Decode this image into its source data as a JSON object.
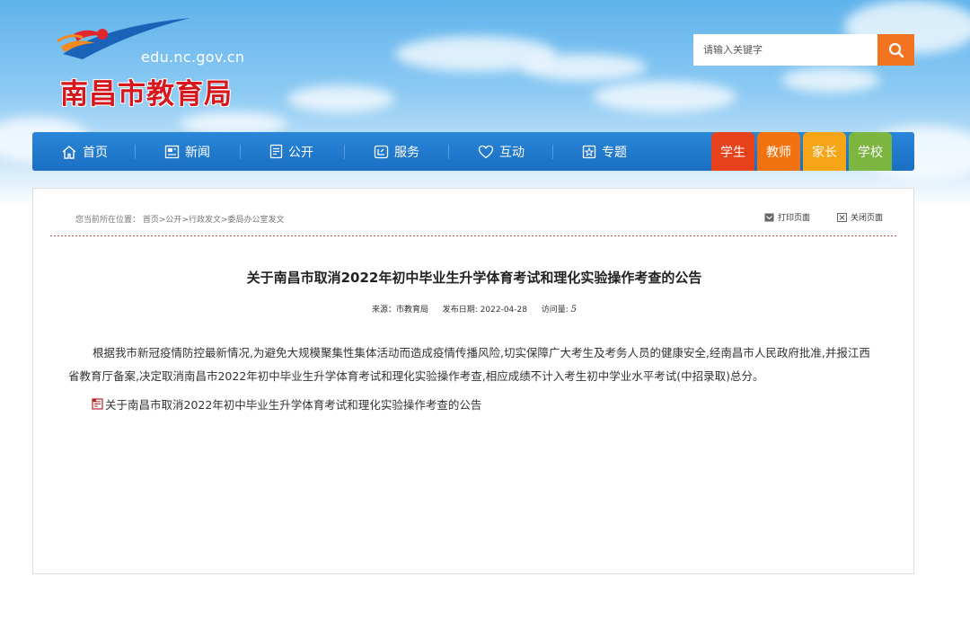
{
  "header": {
    "domain": "edu.nc.gov.cn",
    "site_title": "南昌市教育局"
  },
  "search": {
    "placeholder": "请输入关键字",
    "button_icon": "search-icon"
  },
  "nav": {
    "items": [
      {
        "label": "首页",
        "icon": "home-icon"
      },
      {
        "label": "新闻",
        "icon": "news-icon"
      },
      {
        "label": "公开",
        "icon": "document-icon"
      },
      {
        "label": "服务",
        "icon": "service-icon"
      },
      {
        "label": "互动",
        "icon": "heart-icon"
      },
      {
        "label": "专题",
        "icon": "topic-icon"
      }
    ],
    "roles": [
      {
        "label": "学生",
        "color": "#e8421d"
      },
      {
        "label": "教师",
        "color": "#f1720e"
      },
      {
        "label": "家长",
        "color": "#f6a517"
      },
      {
        "label": "学校",
        "color": "#7cb540"
      }
    ]
  },
  "breadcrumb": {
    "prefix": "您当前所在位置：",
    "path": "首页>公开>行政发文>委局办公室发文"
  },
  "tools": {
    "print_label": "打印页面",
    "close_label": "关闭页面"
  },
  "article": {
    "title": "关于南昌市取消2022年初中毕业生升学体育考试和理化实验操作考查的公告",
    "meta": {
      "source_label": "来源：",
      "source": "市教育局",
      "date_label": "发布日期:",
      "date": "2022-04-28",
      "visits_label": "访问量:",
      "visits": "5"
    },
    "body": "根据我市新冠疫情防控最新情况,为避免大规模聚集性集体活动而造成疫情传播风险,切实保障广大考生及考务人员的健康安全,经南昌市人民政府批准,并报江西省教育厅备案,决定取消南昌市2022年初中毕业生升学体育考试和理化实验操作考查,相应成绩不计入考生初中学业水平考试(中招录取)总分。",
    "attachment": "关于南昌市取消2022年初中毕业生升学体育考试和理化实验操作考查的公告"
  },
  "colors": {
    "brand_red": "#d6171d",
    "nav_blue": "#1f78cd",
    "search_orange": "#f27420"
  }
}
